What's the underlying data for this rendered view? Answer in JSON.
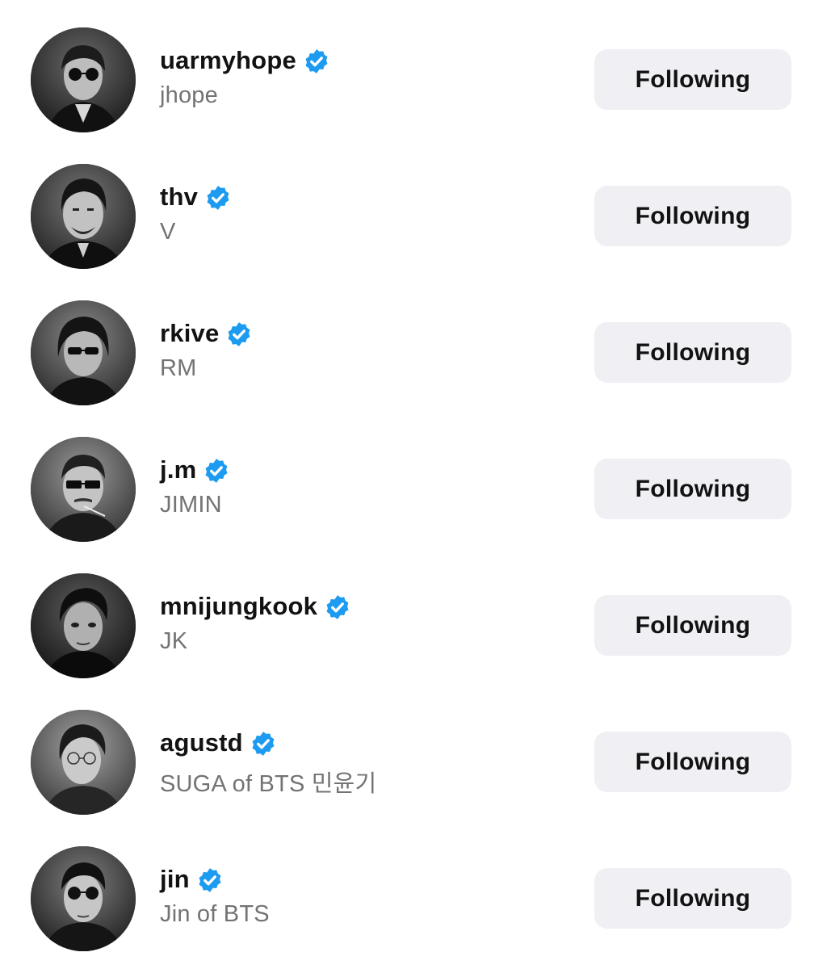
{
  "following_list": {
    "accounts": [
      {
        "username": "uarmyhope",
        "full_name": "jhope",
        "verified": true,
        "button_label": "Following"
      },
      {
        "username": "thv",
        "full_name": "V",
        "verified": true,
        "button_label": "Following"
      },
      {
        "username": "rkive",
        "full_name": "RM",
        "verified": true,
        "button_label": "Following"
      },
      {
        "username": "j.m",
        "full_name": "JIMIN",
        "verified": true,
        "button_label": "Following"
      },
      {
        "username": "mnijungkook",
        "full_name": "JK",
        "verified": true,
        "button_label": "Following"
      },
      {
        "username": "agustd",
        "full_name": "SUGA of BTS 민윤기",
        "verified": true,
        "button_label": "Following"
      },
      {
        "username": "jin",
        "full_name": "Jin of BTS",
        "verified": true,
        "button_label": "Following"
      }
    ]
  },
  "colors": {
    "verified_badge": "#1d9bf0",
    "button_background": "#efeff4",
    "username_text": "#121212",
    "full_name_text": "#737373"
  },
  "icons": {
    "verified": "verified-badge-icon",
    "avatar": "profile-photo"
  }
}
